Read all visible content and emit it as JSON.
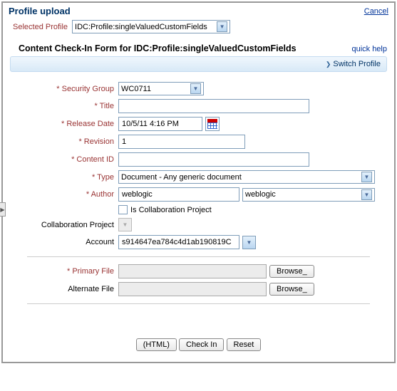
{
  "header": {
    "title": "Profile upload",
    "cancel": "Cancel"
  },
  "selectedProfile": {
    "label": "Selected Profile",
    "value": "IDC:Profile:singleValuedCustomFields"
  },
  "formHeader": {
    "title": "Content Check-In Form for IDC:Profile:singleValuedCustomFields",
    "quickHelp": "quick help",
    "switchProfile": "Switch Profile"
  },
  "fields": {
    "securityGroup": {
      "label": "* Security Group",
      "value": "WC0711"
    },
    "titleField": {
      "label": "* Title",
      "value": ""
    },
    "releaseDate": {
      "label": "* Release Date",
      "value": "10/5/11 4:16 PM"
    },
    "revision": {
      "label": "* Revision",
      "value": "1"
    },
    "contentId": {
      "label": "* Content ID",
      "value": ""
    },
    "type": {
      "label": "* Type",
      "value": "Document - Any generic document"
    },
    "author": {
      "label": "* Author",
      "value1": "weblogic",
      "value2": "weblogic"
    },
    "collabCheck": {
      "label": "Is Collaboration Project"
    },
    "collaborationProject": {
      "label": "Collaboration Project"
    },
    "account": {
      "label": "Account",
      "value": "s914647ea784c4d1ab190819C"
    },
    "primaryFile": {
      "label": "* Primary File",
      "browse": "Browse_"
    },
    "alternateFile": {
      "label": "Alternate File",
      "browse": "Browse_"
    }
  },
  "buttons": {
    "html": "(HTML)",
    "checkIn": "Check In",
    "reset": "Reset"
  }
}
